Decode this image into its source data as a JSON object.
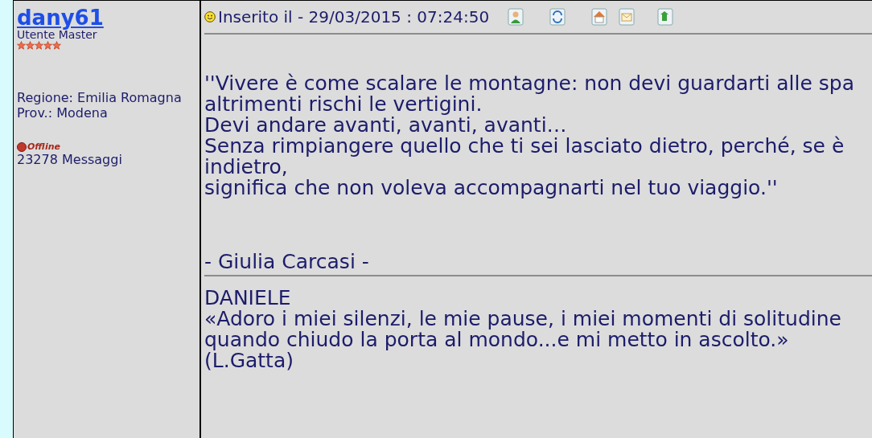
{
  "author": {
    "name": "dany61",
    "rank": "Utente Master",
    "stars": 5,
    "region": "Regione: Emilia Romagna",
    "province": "Prov.: Modena",
    "status": "Offline",
    "online": false,
    "messages": "23278 Messaggi"
  },
  "post": {
    "date": "Inserito il - 29/03/2015 : 07:24:50",
    "body": [
      "''Vivere è come scalare le montagne: non devi guardarti alle spa",
      "altrimenti rischi le vertigini.",
      "Devi andare avanti, avanti, avanti…",
      "Senza rimpiangere quello che ti sei lasciato dietro, perché, se è",
      "indietro,",
      "significa che non voleva accompagnarti nel tuo viaggio.''"
    ],
    "attribution": "- Giulia Carcasi -",
    "signature": [
      "DANIELE",
      "«Adoro i miei silenzi, le mie pause, i miei momenti di solitudine",
      "quando chiudo la porta al mondo...e mi metto in ascolto.»",
      "(L.Gatta)"
    ]
  }
}
